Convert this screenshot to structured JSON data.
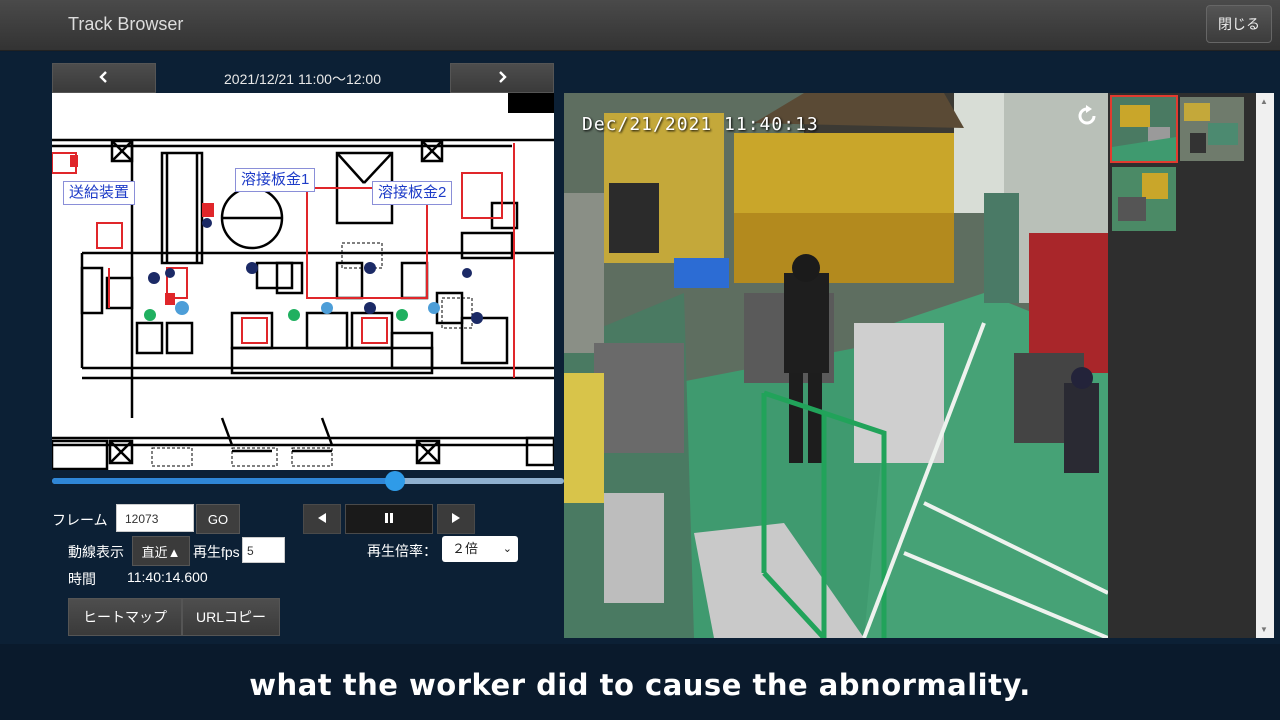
{
  "header": {
    "title": "Track Browser",
    "close_label": "閉じる"
  },
  "map_panel": {
    "date_range": "2021/12/21 11:00～12:00",
    "prev_label": "‹",
    "next_label": "›",
    "zones": [
      "送給装置",
      "溶接板金1",
      "溶接板金2"
    ]
  },
  "timeline": {
    "position_fraction": 0.67
  },
  "controls": {
    "frame_label": "フレーム",
    "frame_value": "12073",
    "go_label": "GO",
    "trail_label": "動線表示",
    "trail_value": "直近▲",
    "fps_label": "再生fps",
    "fps_value": "5",
    "speed_label": "再生倍率：",
    "speed_value": "２倍",
    "time_label": "時間",
    "time_value": "11:40:14.600",
    "heatmap_label": "ヒートマップ",
    "copy_url_label": "URLコピー"
  },
  "camera": {
    "timestamp": "Dec/21/2021  11:40:13"
  },
  "subtitle": "what the worker did to cause the abnormality.",
  "colors": {
    "accent": "#2f86d6",
    "selected_thumb": "#e23b2f",
    "zone_border": "#e0262a"
  },
  "icons": [
    "chevron-left-icon",
    "chevron-right-icon",
    "step-back-icon",
    "pause-icon",
    "step-forward-icon",
    "refresh-icon"
  ]
}
